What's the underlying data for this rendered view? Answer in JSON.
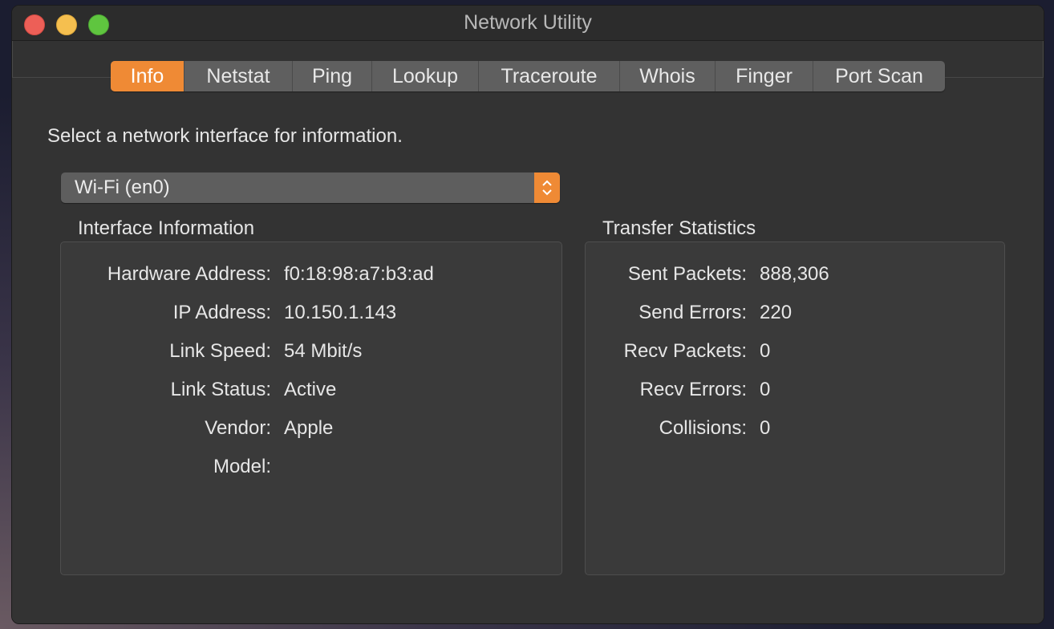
{
  "window": {
    "title": "Network Utility"
  },
  "tabs": [
    {
      "label": "Info",
      "active": true
    },
    {
      "label": "Netstat",
      "active": false
    },
    {
      "label": "Ping",
      "active": false
    },
    {
      "label": "Lookup",
      "active": false
    },
    {
      "label": "Traceroute",
      "active": false
    },
    {
      "label": "Whois",
      "active": false
    },
    {
      "label": "Finger",
      "active": false
    },
    {
      "label": "Port Scan",
      "active": false
    }
  ],
  "intro_text": "Select a network interface for information.",
  "interface_select": {
    "selected": "Wi-Fi (en0)"
  },
  "interface_info": {
    "heading": "Interface Information",
    "rows": [
      {
        "label": "Hardware Address:",
        "value": "f0:18:98:a7:b3:ad"
      },
      {
        "label": "IP Address:",
        "value": "10.150.1.143"
      },
      {
        "label": "Link Speed:",
        "value": "54 Mbit/s"
      },
      {
        "label": "Link Status:",
        "value": "Active"
      },
      {
        "label": "Vendor:",
        "value": "Apple"
      },
      {
        "label": "Model:",
        "value": ""
      }
    ]
  },
  "transfer_stats": {
    "heading": "Transfer Statistics",
    "rows": [
      {
        "label": "Sent Packets:",
        "value": "888,306"
      },
      {
        "label": "Send Errors:",
        "value": "220"
      },
      {
        "label": "Recv Packets:",
        "value": "0"
      },
      {
        "label": "Recv Errors:",
        "value": "0"
      },
      {
        "label": "Collisions:",
        "value": "0"
      }
    ]
  },
  "colors": {
    "accent": "#ef8a35",
    "window_bg": "#323232",
    "close": "#ed5f57",
    "minimize": "#f5bf4f",
    "maximize": "#5fc53f"
  }
}
